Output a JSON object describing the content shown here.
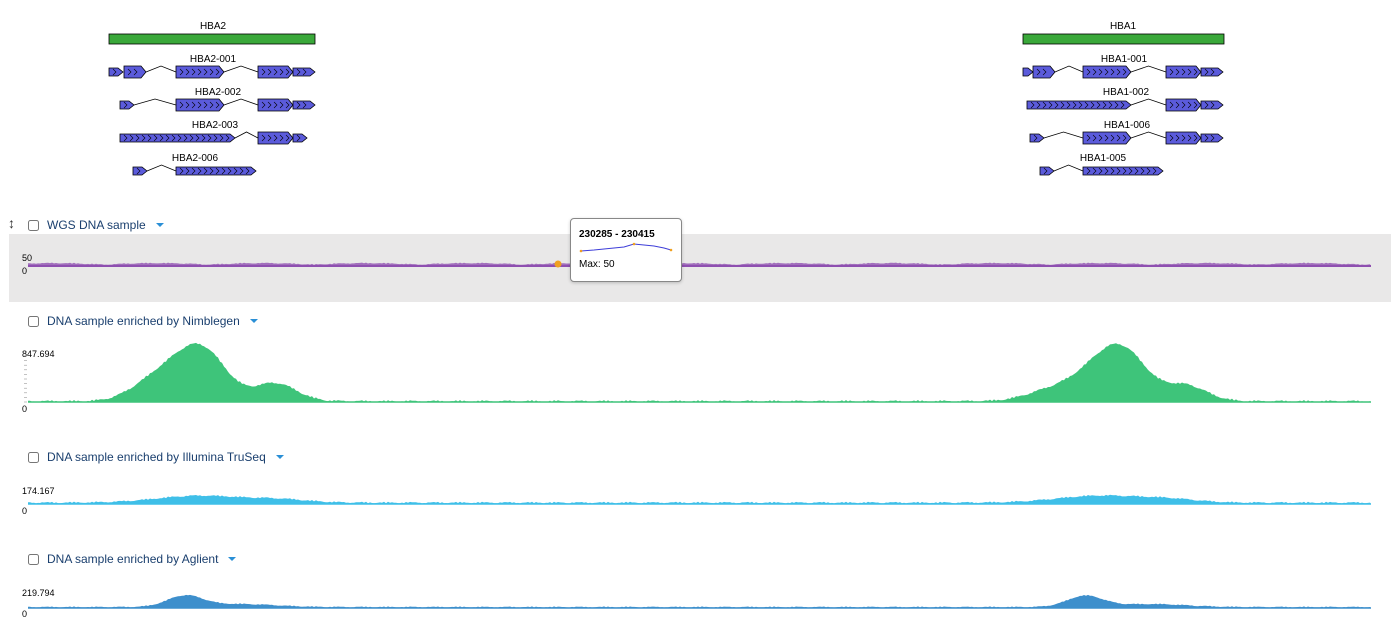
{
  "genes": [
    {
      "name": "HBA2",
      "transcripts": [
        "HBA2-001",
        "HBA2-002",
        "HBA2-003",
        "HBA2-006"
      ]
    },
    {
      "name": "HBA1",
      "transcripts": [
        "HBA1-001",
        "HBA1-002",
        "HBA1-006",
        "HBA1-005"
      ]
    }
  ],
  "colors": {
    "gene": "#3aa83a",
    "exon": "#5b5bdb",
    "wgs": "#8e4fb0",
    "nimblegen": "#3ec47a",
    "illumina": "#3fbfe8",
    "aglient": "#3d8fcc",
    "highlight_bg": "#e9e8e8",
    "tooltip_point": "#f0a020"
  },
  "tracks": [
    {
      "label": "WGS DNA sample",
      "max_label": "50",
      "zero_label": "0"
    },
    {
      "label": "DNA sample enriched by Nimblegen",
      "max_label": "847.694",
      "zero_label": "0"
    },
    {
      "label": "DNA sample enriched by Illumina TruSeq",
      "max_label": "174.167",
      "zero_label": "0"
    },
    {
      "label": "DNA sample enriched by Aglient",
      "max_label": "219.794",
      "zero_label": "0"
    }
  ],
  "tooltip": {
    "range": "230285 - 230415",
    "max": "Max: 50"
  }
}
